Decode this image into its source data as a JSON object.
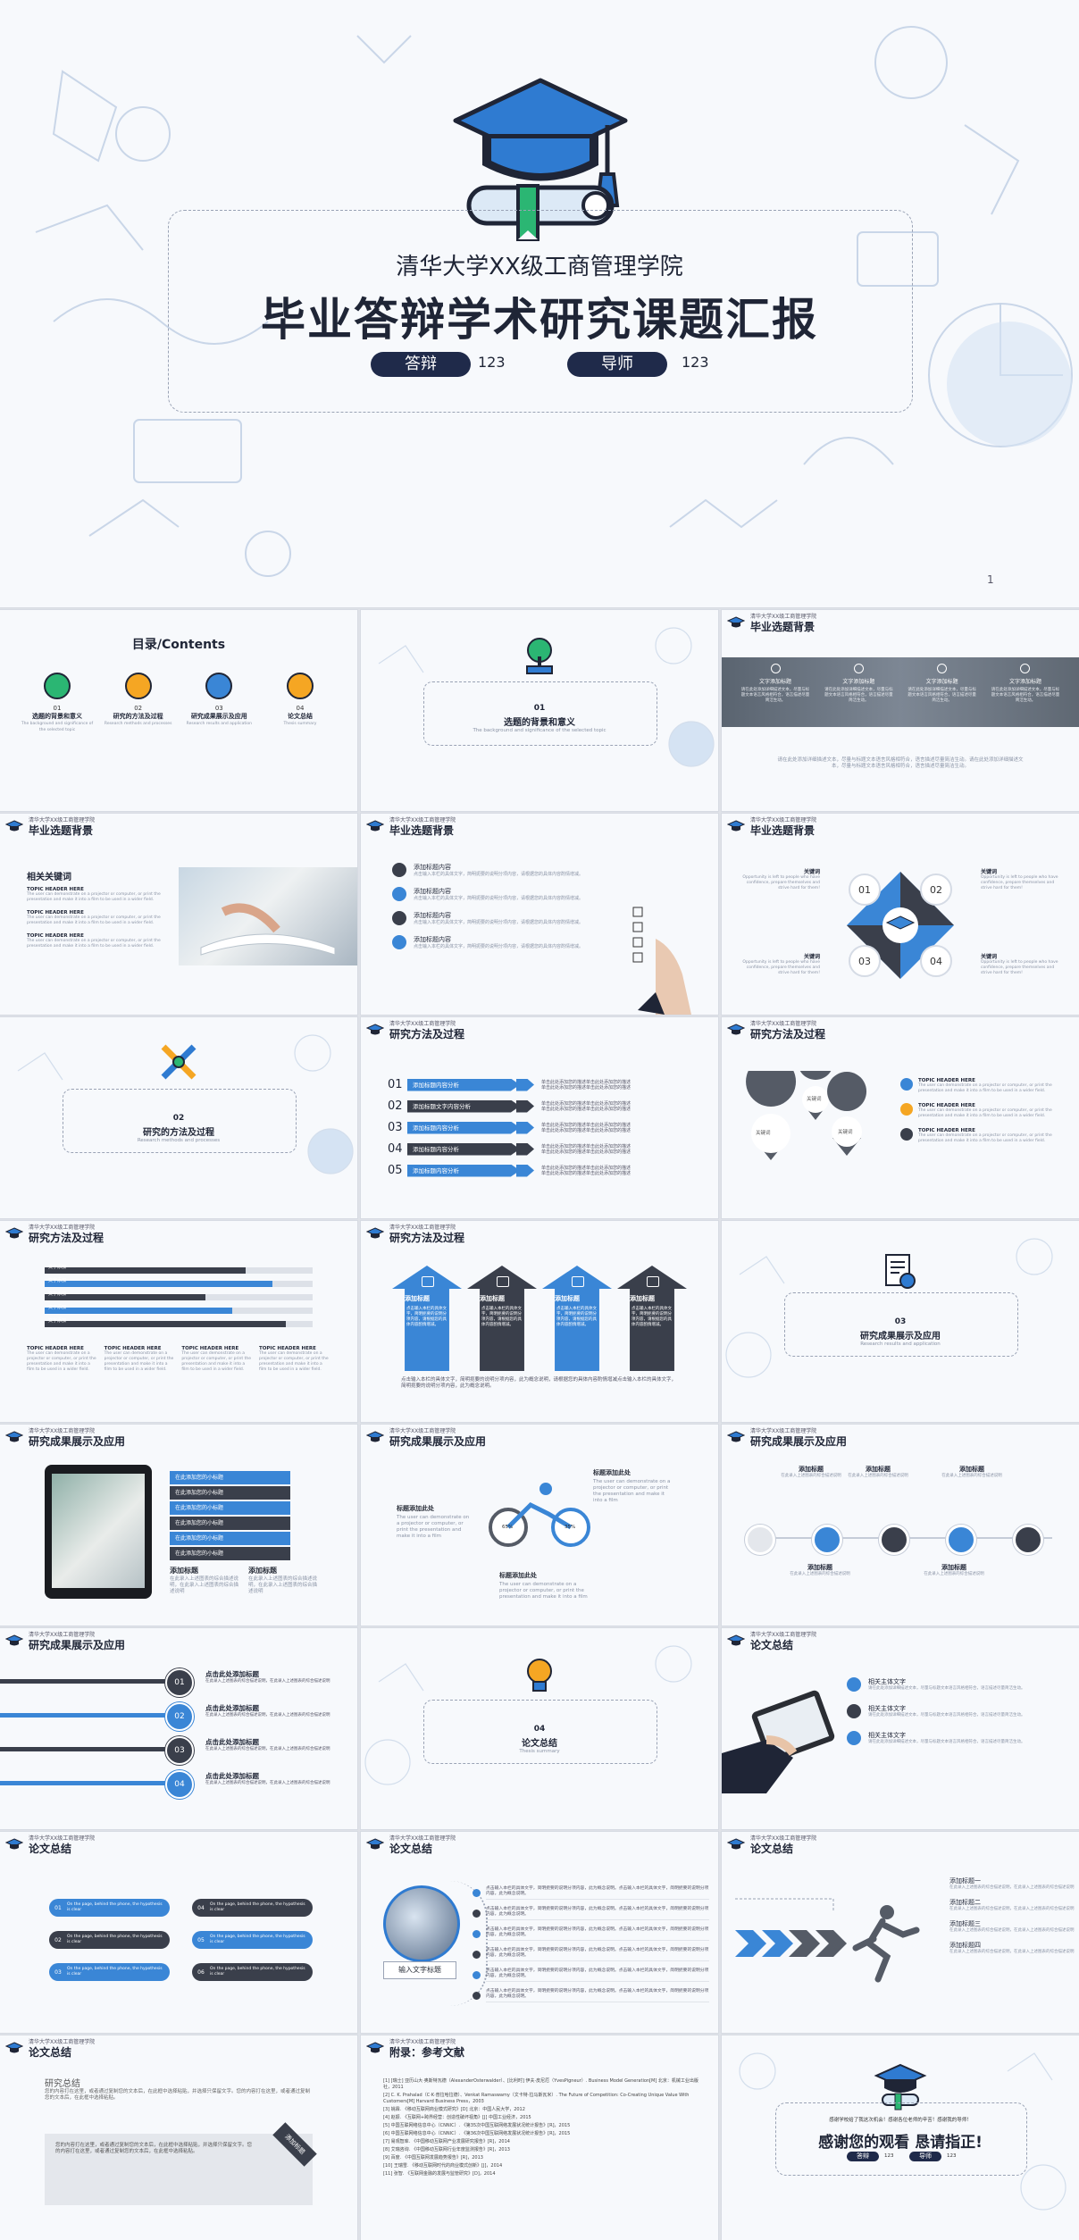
{
  "colors": {
    "blue": "#3a86d6",
    "dark": "#3a3f4b",
    "navy": "#1f2536",
    "orange": "#f5a623",
    "green": "#2bb673",
    "teal": "#1ea7a0"
  },
  "cover": {
    "school": "清华大学XX级工商管理学院",
    "title": "毕业答辩学术研究课题汇报",
    "defense_label": "答辩",
    "defense_value": "123",
    "advisor_label": "导师",
    "advisor_value": "123",
    "page_num": "1"
  },
  "header": {
    "school": "清华大学XX级工商管理学院"
  },
  "toc": {
    "title": "目录/Contents",
    "items": [
      {
        "num": "01",
        "label": "选题的背景和意义",
        "desc": "The background and significance of the selected topic",
        "icon": "tree-book-icon"
      },
      {
        "num": "02",
        "label": "研究的方法及过程",
        "desc": "Research methods and processes",
        "icon": "tools-icon"
      },
      {
        "num": "03",
        "label": "研究成果展示及应用",
        "desc": "Research results and application",
        "icon": "certificate-icon"
      },
      {
        "num": "04",
        "label": "论文总结",
        "desc": "Thesis summary",
        "icon": "bulb-icon"
      }
    ]
  },
  "s3": {
    "num": "01",
    "title": "选题的背景和意义",
    "desc": "The background and significance of the selected topic"
  },
  "s4": {
    "title": "毕业选题背景",
    "cols": [
      "文字添加标题",
      "文字添加标题",
      "文字添加标题",
      "文字添加标题"
    ],
    "text": "请在此处添加详细描述文本，尽量与标题文本语言风格相符合，语言描述尽量简洁生动。",
    "footer": "请在此处添加详细描述文本，尽量与标题文本语言风格相符合，语言描述尽量简洁生动。请在此处添加详细描述文本，尽量与标题文本语言风格相符合，语言描述尽量简洁生动。"
  },
  "s5": {
    "title": "毕业选题背景",
    "heading": "相关关键词",
    "items": [
      "TOPIC HEADER HERE",
      "TOPIC HEADER HERE",
      "TOPIC HEADER HERE"
    ],
    "desc": "The user can demonstrate on a projector or computer, or print the presentation and make it into a film to be used in a wider field."
  },
  "s6": {
    "title": "毕业选题背景",
    "items": [
      "添加标题内容",
      "添加标题内容",
      "添加标题内容",
      "添加标题内容"
    ],
    "text": "点击输入本栏的具体文字，简明扼要的说明分项内容，请根据您的具体内容酌情增减。"
  },
  "s7": {
    "title": "毕业选题背景",
    "kw": [
      "关键词",
      "关键词",
      "关键词",
      "关键词"
    ],
    "nums": [
      "01",
      "02",
      "03",
      "04"
    ],
    "desc": "Opportunity is left to people who have confidence, prepare themselves and strive hard for them!"
  },
  "s8": {
    "num": "02",
    "title": "研究的方法及过程",
    "desc": "Research methods and processes"
  },
  "s9": {
    "title": "研究方法及过程",
    "nums": [
      "01",
      "02",
      "03",
      "04",
      "05"
    ],
    "labels": [
      "添加标题内容分析",
      "添加标题文字内容分析",
      "添加标题内容分析",
      "添加标题内容分析",
      "添加标题内容分析"
    ],
    "text": "单击此处添加您的描述单击此处添加您的描述"
  },
  "s10": {
    "title": "研究方法及过程",
    "kw": [
      "关键词",
      "关键词",
      "关键词"
    ],
    "topics": [
      "TOPIC HEADER HERE",
      "TOPIC HEADER HERE",
      "TOPIC HEADER HERE"
    ],
    "desc": "The user can demonstrate on a projector or computer, or print the presentation and make it into a film to be used in a wider field."
  },
  "s11": {
    "title": "研究方法及过程",
    "bars": [
      {
        "label": "文字添加",
        "value": 0.75
      },
      {
        "label": "文字添加",
        "value": 0.85
      },
      {
        "label": "文字添加",
        "value": 0.6
      },
      {
        "label": "文字添加",
        "value": 0.7
      },
      {
        "label": "文字添加",
        "value": 0.9
      }
    ],
    "topics": [
      "TOPIC HEADER HERE",
      "TOPIC HEADER HERE",
      "TOPIC HEADER HERE",
      "TOPIC HEADER HERE"
    ],
    "desc": "The user can demonstrate on a projector or computer, or print the presentation and make it into a film to be used in a wider field."
  },
  "s12": {
    "title": "研究方法及过程",
    "labels": [
      "添加标题",
      "添加标题",
      "添加标题",
      "添加标题"
    ],
    "text": "点击输入本栏的具体文字，简明扼要的说明分项内容，请根据您的具体内容酌情增减。",
    "footer": "点击输入本栏的具体文字，简明扼要的说明分项内容，此为概念说明，请根据您的具体内容酌情增减点击输入本栏的具体文字，简明扼要的说明分项内容，此为概念说明。"
  },
  "s13": {
    "num": "03",
    "title": "研究成果展示及应用",
    "desc": "Research results and application"
  },
  "s14": {
    "title": "研究成果展示及应用",
    "rows": [
      "在此添加您的小标题",
      "在此添加您的小标题",
      "在此添加您的小标题",
      "在此添加您的小标题",
      "在此添加您的小标题",
      "在此添加您的小标题"
    ],
    "h1": "添加标题",
    "h2": "添加标题",
    "text": "在此录入上述图表的综合描述说明，在此录入上述图表的综合描述说明"
  },
  "s15": {
    "title": "研究成果展示及应用",
    "labels": [
      "标题添加此处",
      "标题添加此处",
      "标题添加此处"
    ],
    "pct1": "65%",
    "pct2": "35%",
    "desc": "The user can demonstrate on a projector or computer, or print the presentation and make it into a film"
  },
  "s16": {
    "title": "研究成果展示及应用",
    "labels": [
      "添加标题",
      "添加标题",
      "添加标题",
      "添加标题",
      "添加标题"
    ],
    "text": "在此录入上述图表的综合描述说明"
  },
  "s17": {
    "title": "研究成果展示及应用",
    "nums": [
      "01",
      "02",
      "03",
      "04"
    ],
    "label": "点击此处添加标题",
    "text": "在此录入上述图表的综合描述说明，在此录入上述图表的综合描述说明"
  },
  "s18": {
    "num": "04",
    "title": "论文总结",
    "desc": "Thesis summary"
  },
  "s19": {
    "title": "论文总结",
    "items": [
      "相关主体文字",
      "相关主体文字",
      "相关主体文字"
    ],
    "text": "请在此处添加详细描述文本，尽量与标题文本语言风格相符合，语言描述尽量简洁生动。"
  },
  "s20": {
    "title": "论文总结",
    "nums": [
      "01",
      "02",
      "03",
      "04",
      "05",
      "06"
    ],
    "text": "On the page, behind the phone, the hypothesis is clear"
  },
  "s21": {
    "title": "论文总结",
    "caption": "输入文字标题",
    "text": "点击输入本栏的具体文字，简明扼要的说明分项内容，此为概念说明。"
  },
  "s22": {
    "title": "论文总结",
    "items": [
      "添加标题一",
      "添加标题二",
      "添加标题三",
      "添加标题四"
    ],
    "text": "在此录入上述图表的综合描述说明，在此录入上述图表的综合描述说明"
  },
  "s23": {
    "title": "论文总结",
    "heading": "研究总结",
    "text": "您的内容打在这里，或者通过复制您的文本后，在此框中选择粘贴，并选择只保留文字。您的内容打在这里，或者通过复制您的文本后，在此框中选择粘贴。",
    "tag": "添加标题"
  },
  "s24": {
    "title": "附录：参考文献",
    "refs": [
      "[1] [瑞士] 亚历山大·奥斯特瓦德（AlexanderOsterwalder）、[比利时] 伊夫·皮尼厄（YvesPigneur）. Business Model Generation[M] 北京：机械工业出版社，2011",
      "[2] C. K. Prahalad（C·K·普拉哈拉德）、Venkat Ramaswamy（文卡特·拉马斯瓦米）. The Future of Competition: Co-Creating Unique Value With Customers[M] Harvard Business Press，2003",
      "[3] 姚霖. 《移动互联网商业模式研究》[D] 北京：中国人民大学，2012",
      "[4] 赵振. 《互联网+跨界经营：创造性破坏视角》[J] 中国工业经济，2015",
      "[5] 中国互联网络信息中心（CNNIC）. 《第35次中国互联网络发展状况统计报告》[R]，2015",
      "[6] 中国互联网络信息中心（CNNIC）. 《第36次中国互联网络发展状况统计报告》[R]，2015",
      "[7] 易观智库. 《中国移动互联网产业发展研究报告》[R]，2014",
      "[8] 艾瑞咨询. 《中国移动互联网行业年度监测报告》[R]，2013",
      "[9] 百度. 《中国互联网发展趋势报告》[R]，2013",
      "[10] 王瑞雪. 《移动互联网时代的商业模式创新》[J]，2014",
      "[11] 张智. 《互联网金融的发展与监管研究》[D]，2014"
    ]
  },
  "s25": {
    "sub": "感谢学校给了我这次机会！感谢各位老师的辛苦！感谢我的导师！",
    "title": "感谢您的观看 恳请指正!",
    "label1": "答辩",
    "label2": "导师",
    "value": "123"
  }
}
